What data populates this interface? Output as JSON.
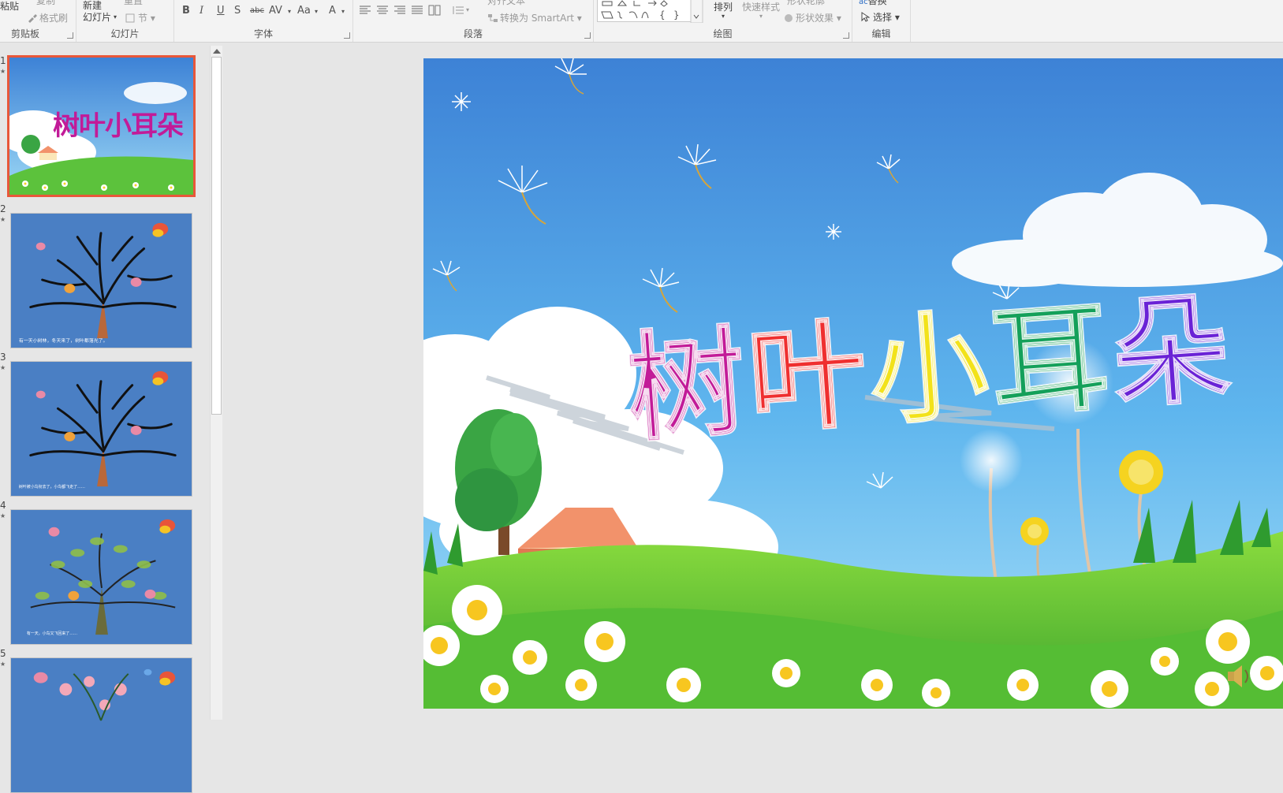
{
  "ribbon": {
    "clipboard": {
      "paste_label": "粘贴",
      "copy_label": "复制",
      "format_painter_label": "格式刷",
      "group_label": "剪贴板"
    },
    "slides": {
      "new_slide_label": "新建\n幻灯片",
      "reset_label": "重置",
      "section_label": "节",
      "group_label": "幻灯片"
    },
    "font": {
      "bold": "B",
      "italic": "I",
      "underline": "U",
      "shadow": "S",
      "strike": "abc",
      "spacing": "AV",
      "case": "Aa",
      "color": "A",
      "group_label": "字体"
    },
    "paragraph": {
      "align_text_label": "对齐文本",
      "smartart_label": "转换为 SmartArt",
      "group_label": "段落"
    },
    "drawing": {
      "arrange_label": "排列",
      "quick_styles_label": "快速样式",
      "shape_outline_label": "形状轮廓",
      "shape_effects_label": "形状效果",
      "group_label": "绘图"
    },
    "editing": {
      "replace_label": "替换",
      "select_label": "选择",
      "group_label": "编辑"
    }
  },
  "thumbnails": [
    {
      "number": "1",
      "selected": true,
      "theme": "title"
    },
    {
      "number": "2",
      "selected": false,
      "theme": "bare-tree",
      "caption": "有一天小树林，冬天来了，树叶都落光了。"
    },
    {
      "number": "3",
      "selected": false,
      "theme": "bare-tree",
      "caption": "树叶被小鸟衔去了，小鸟都飞走了……"
    },
    {
      "number": "4",
      "selected": false,
      "theme": "green-tree",
      "caption": "有一天，小鸟又飞回来了……"
    },
    {
      "number": "5",
      "selected": false,
      "theme": "flower-tree"
    }
  ],
  "slide": {
    "title_chars": [
      {
        "char": "树",
        "color": "#c21b98"
      },
      {
        "char": "叶",
        "color": "#ef2f2f"
      },
      {
        "char": "小",
        "color": "#f2e21a"
      },
      {
        "char": "耳",
        "color": "#14a05a"
      },
      {
        "char": "朵",
        "color": "#6a22d6"
      }
    ],
    "thumb_title": "树叶小耳朵"
  },
  "colors": {
    "selection_border": "#e8573a",
    "sky_top": "#3d82d6",
    "sky_bottom": "#8fd2f4",
    "grass": "#59c13a",
    "slide_bg_blue": "#4a7fc4"
  }
}
